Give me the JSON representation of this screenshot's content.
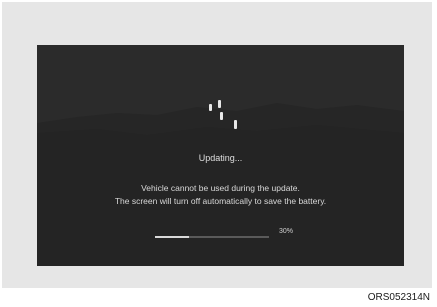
{
  "update_screen": {
    "status": "Updating...",
    "message_line1": "Vehicle cannot be used during the update.",
    "message_line2": "The screen will turn off automatically to save the battery.",
    "progress_fraction": 0.3,
    "progress_label": "30%",
    "spinner_icon": "loading-spinner-icon"
  },
  "figure": {
    "code": "ORS052314N"
  },
  "colors": {
    "screen_background": "#2b2b2b",
    "frame_background": "#e6e6e6",
    "text": "#dedede",
    "progress_fill": "#d9d9d9",
    "progress_track": "#5a5a5a"
  }
}
